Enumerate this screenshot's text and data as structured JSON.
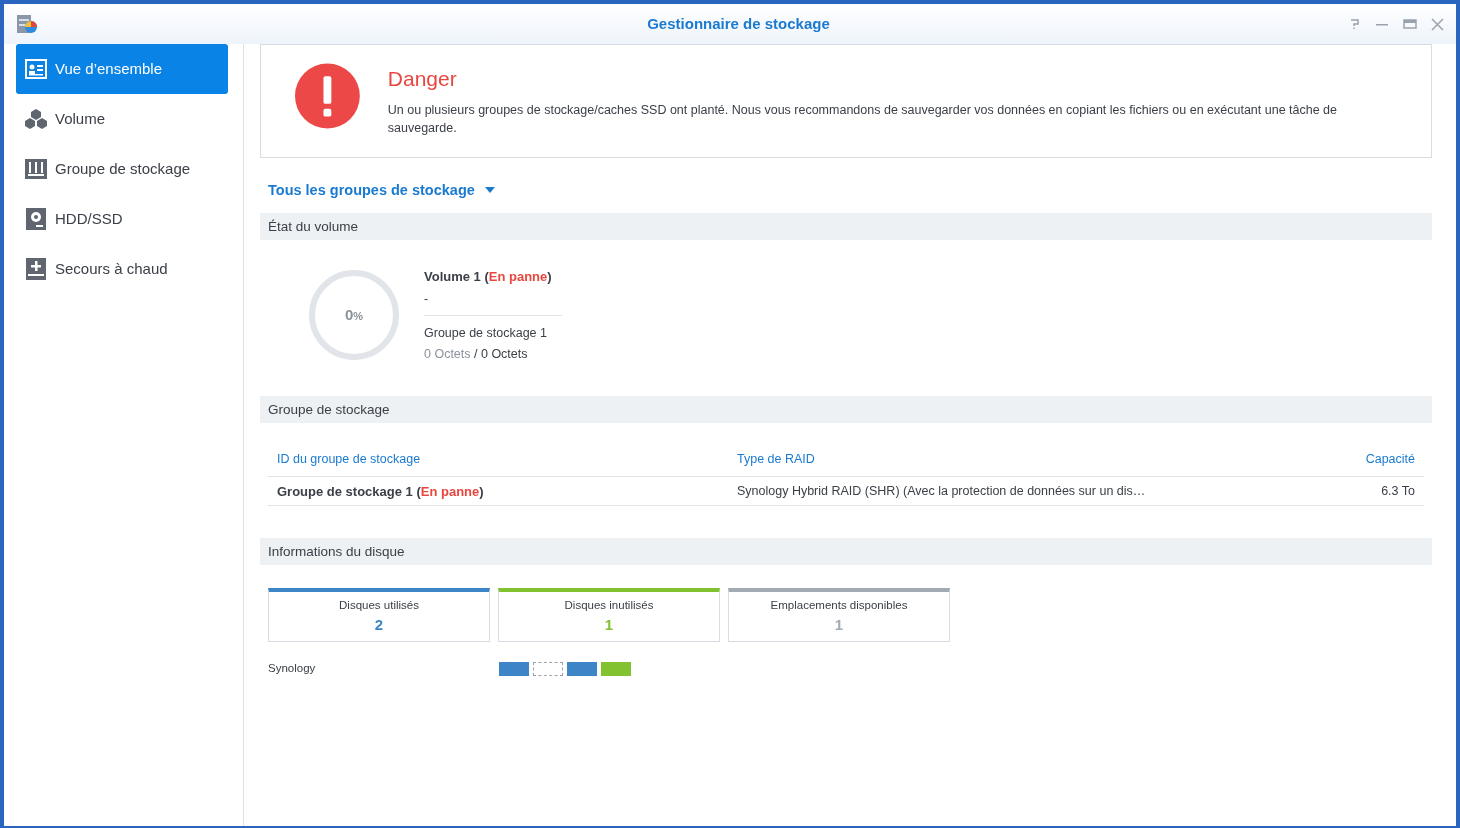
{
  "window": {
    "title": "Gestionnaire de stockage"
  },
  "sidebar": {
    "items": [
      {
        "label": "Vue d’ensemble",
        "selected": true
      },
      {
        "label": "Volume",
        "selected": false
      },
      {
        "label": "Groupe de stockage",
        "selected": false
      },
      {
        "label": "HDD/SSD",
        "selected": false
      },
      {
        "label": "Secours à chaud",
        "selected": false
      }
    ]
  },
  "alert": {
    "title": "Danger",
    "message": "Un ou plusieurs groupes de stockage/caches SSD ont planté. Nous vous recommandons de sauvegarder vos données en copiant les fichiers ou en exécutant une tâche de sauvegarde."
  },
  "filter": {
    "label": "Tous les groupes de stockage"
  },
  "volume_section": {
    "title": "État du volume",
    "usage": {
      "value": "0",
      "unit": "%"
    },
    "name": "Volume 1 (",
    "status": "En panne",
    "close": ")",
    "detail": "-",
    "pool": "Groupe de stockage 1",
    "used": "0 Octets",
    "separator": " / ",
    "total": "0 Octets"
  },
  "pool_section": {
    "title": "Groupe de stockage",
    "columns": [
      "ID du groupe de stockage",
      "Type de RAID",
      "Capacité"
    ],
    "rows": [
      {
        "name": "Groupe de stockage 1 (",
        "status": "En panne",
        "close": ")",
        "raid": "Synology Hybrid RAID (SHR) (Avec la protection de données sur un dis…",
        "capacity": "6.3 To"
      }
    ]
  },
  "disk_section": {
    "title": "Informations du disque",
    "stats": [
      {
        "label": "Disques utilisés",
        "value": "2",
        "color": "#3d85c6"
      },
      {
        "label": "Disques inutilisés",
        "value": "1",
        "color": "#82c12f"
      },
      {
        "label": "Emplacements disponibles",
        "value": "1",
        "color": "#a3aab3"
      }
    ],
    "device": "Synology",
    "slots": [
      {
        "kind": "used"
      },
      {
        "kind": "empty"
      },
      {
        "kind": "used"
      },
      {
        "kind": "unused"
      }
    ]
  }
}
